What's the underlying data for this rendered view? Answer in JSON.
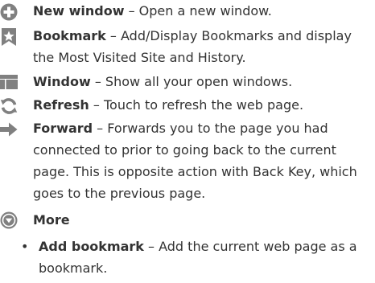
{
  "items": [
    {
      "term": "New window",
      "desc": " – Open a new window.",
      "icon": "plus-circle-icon"
    },
    {
      "term": "Bookmark",
      "desc": " – Add/Display Bookmarks and display the Most Visited Site and History.",
      "icon": "bookmark-star-icon"
    },
    {
      "term": "Window",
      "desc": " – Show all your open windows.",
      "icon": "windows-icon"
    },
    {
      "term": "Refresh",
      "desc": " – Touch to refresh the web page.",
      "icon": "refresh-icon"
    },
    {
      "term": "Forward",
      "desc": " – Forwards you to the page you had connected to prior to going back to the current page. This is opposite action with Back Key, which goes to the previous page.",
      "icon": "forward-arrow-icon"
    },
    {
      "term": "More",
      "desc": "",
      "icon": "chevron-down-circle-icon"
    }
  ],
  "sub_items": [
    {
      "bullet": "•",
      "term": "Add bookmark",
      "desc": " – Add the current web page as a bookmark."
    }
  ],
  "colors": {
    "icon_gray": "#7d7d7d",
    "text": "#333333"
  }
}
